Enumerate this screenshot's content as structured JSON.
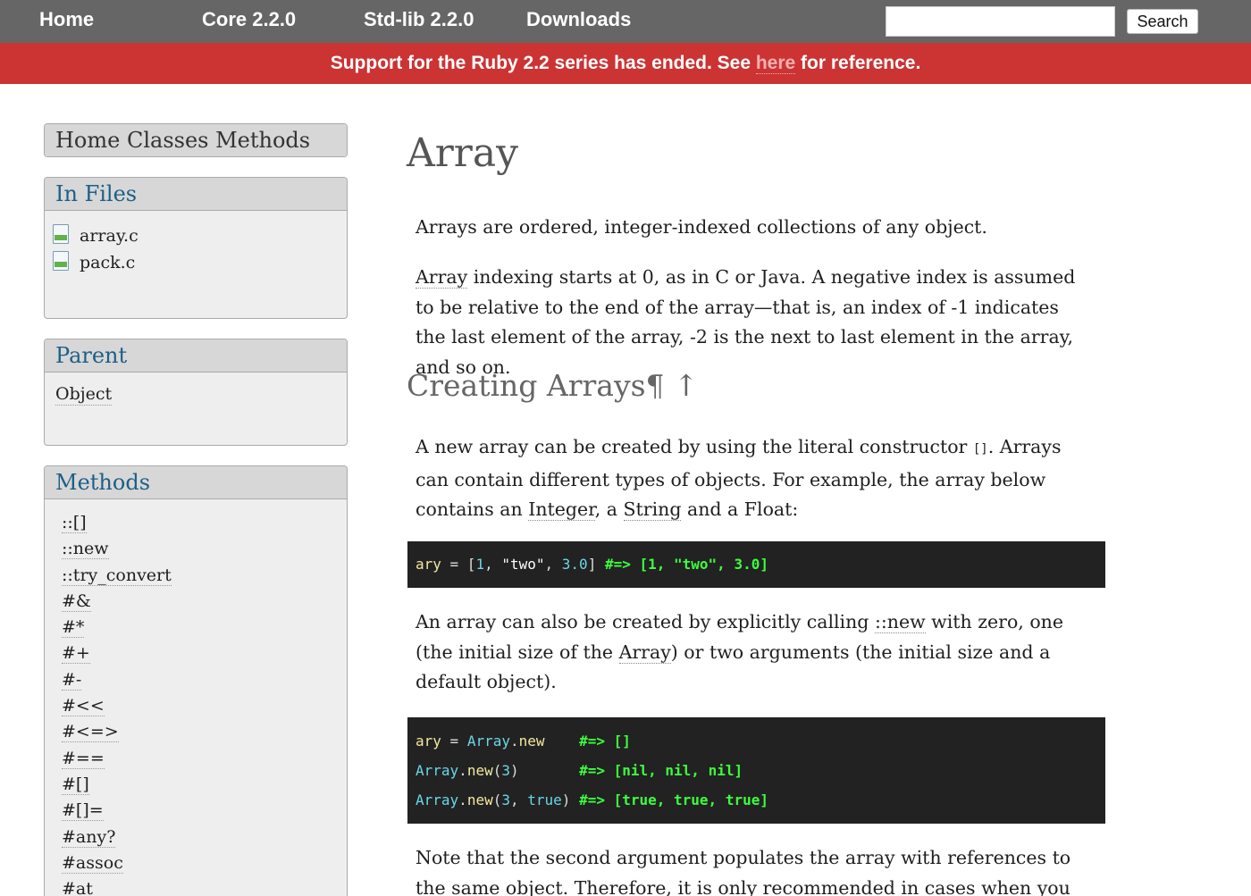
{
  "nav": {
    "home": "Home",
    "core": "Core 2.2.0",
    "stdlib": "Std-lib 2.2.0",
    "downloads": "Downloads",
    "search_placeholder": "",
    "search_button": "Search"
  },
  "banner": {
    "before": "Support for the Ruby 2.2 series has ended. See ",
    "link": "here",
    "after": " for reference."
  },
  "sidebar": {
    "nav_label": "Home Classes Methods",
    "files_title": "In Files",
    "files": [
      "array.c",
      "pack.c"
    ],
    "parent_title": "Parent",
    "parent": "Object",
    "methods_title": "Methods",
    "methods": [
      "::[]",
      "::new",
      "::try_convert",
      "#&",
      "#*",
      "#+",
      "#-",
      "#<<",
      "#<=>",
      "#==",
      "#[]",
      "#[]=",
      "#any?",
      "#assoc",
      "#at"
    ]
  },
  "main": {
    "title": "Array",
    "p1": "Arrays are ordered, integer-indexed collections of any object.",
    "p2": {
      "link": "Array",
      "text": " indexing starts at 0, as in C or Java. A negative index is assumed to be relative to the end of the array—that is, an index of -1 indicates the last element of the array, -2 is the next to last element in the array, and so on."
    },
    "section_title": "Creating Arrays",
    "section_marks": "¶ ↑",
    "p3": {
      "a": "A new array can be created by using the literal constructor ",
      "code": "[]",
      "b": ". Arrays can contain different types of objects. For example, the array below contains an ",
      "link1": "Integer",
      "c": ", a ",
      "link2": "String",
      "d": " and a Float:"
    },
    "code1": {
      "var": "ary",
      "eq": " = [",
      "n1": "1",
      "comma1": ", ",
      "str": "\"two\"",
      "comma2": ", ",
      "n2": "3.0",
      "close": "] ",
      "comment": "#=> [1, \"two\", 3.0]"
    },
    "p4": {
      "a": "An array can also be created by explicitly calling ",
      "link1": "::new",
      "b": " with zero, one (the initial size of the ",
      "link2": "Array",
      "c": ") or two arguments (the initial size and a default object)."
    },
    "code2": {
      "l1_var": "ary",
      "l1_eq": " = ",
      "l1_const": "Array",
      "l1_dot": ".",
      "l1_meth": "new",
      "l1_pad": "    ",
      "l1_cmt": "#=> []",
      "l2_const": "Array",
      "l2_dot": ".",
      "l2_meth": "new",
      "l2_open": "(",
      "l2_num": "3",
      "l2_close": ")",
      "l2_pad": "       ",
      "l2_cmt": "#=> [nil, nil, nil]",
      "l3_const": "Array",
      "l3_dot": ".",
      "l3_meth": "new",
      "l3_open": "(",
      "l3_num": "3",
      "l3_comma": ", ",
      "l3_kw": "true",
      "l3_close": ") ",
      "l3_cmt": "#=> [true, true, true]"
    },
    "p5": "Note that the second argument populates the array with references to the same object. Therefore, it is only recommended in cases when you need to"
  },
  "colors": {
    "nav_bg": "#666666",
    "banner_bg": "#cc3333",
    "link_blue": "#1d5f86",
    "code_bg": "#222222",
    "code_comment": "#3dff3d"
  }
}
